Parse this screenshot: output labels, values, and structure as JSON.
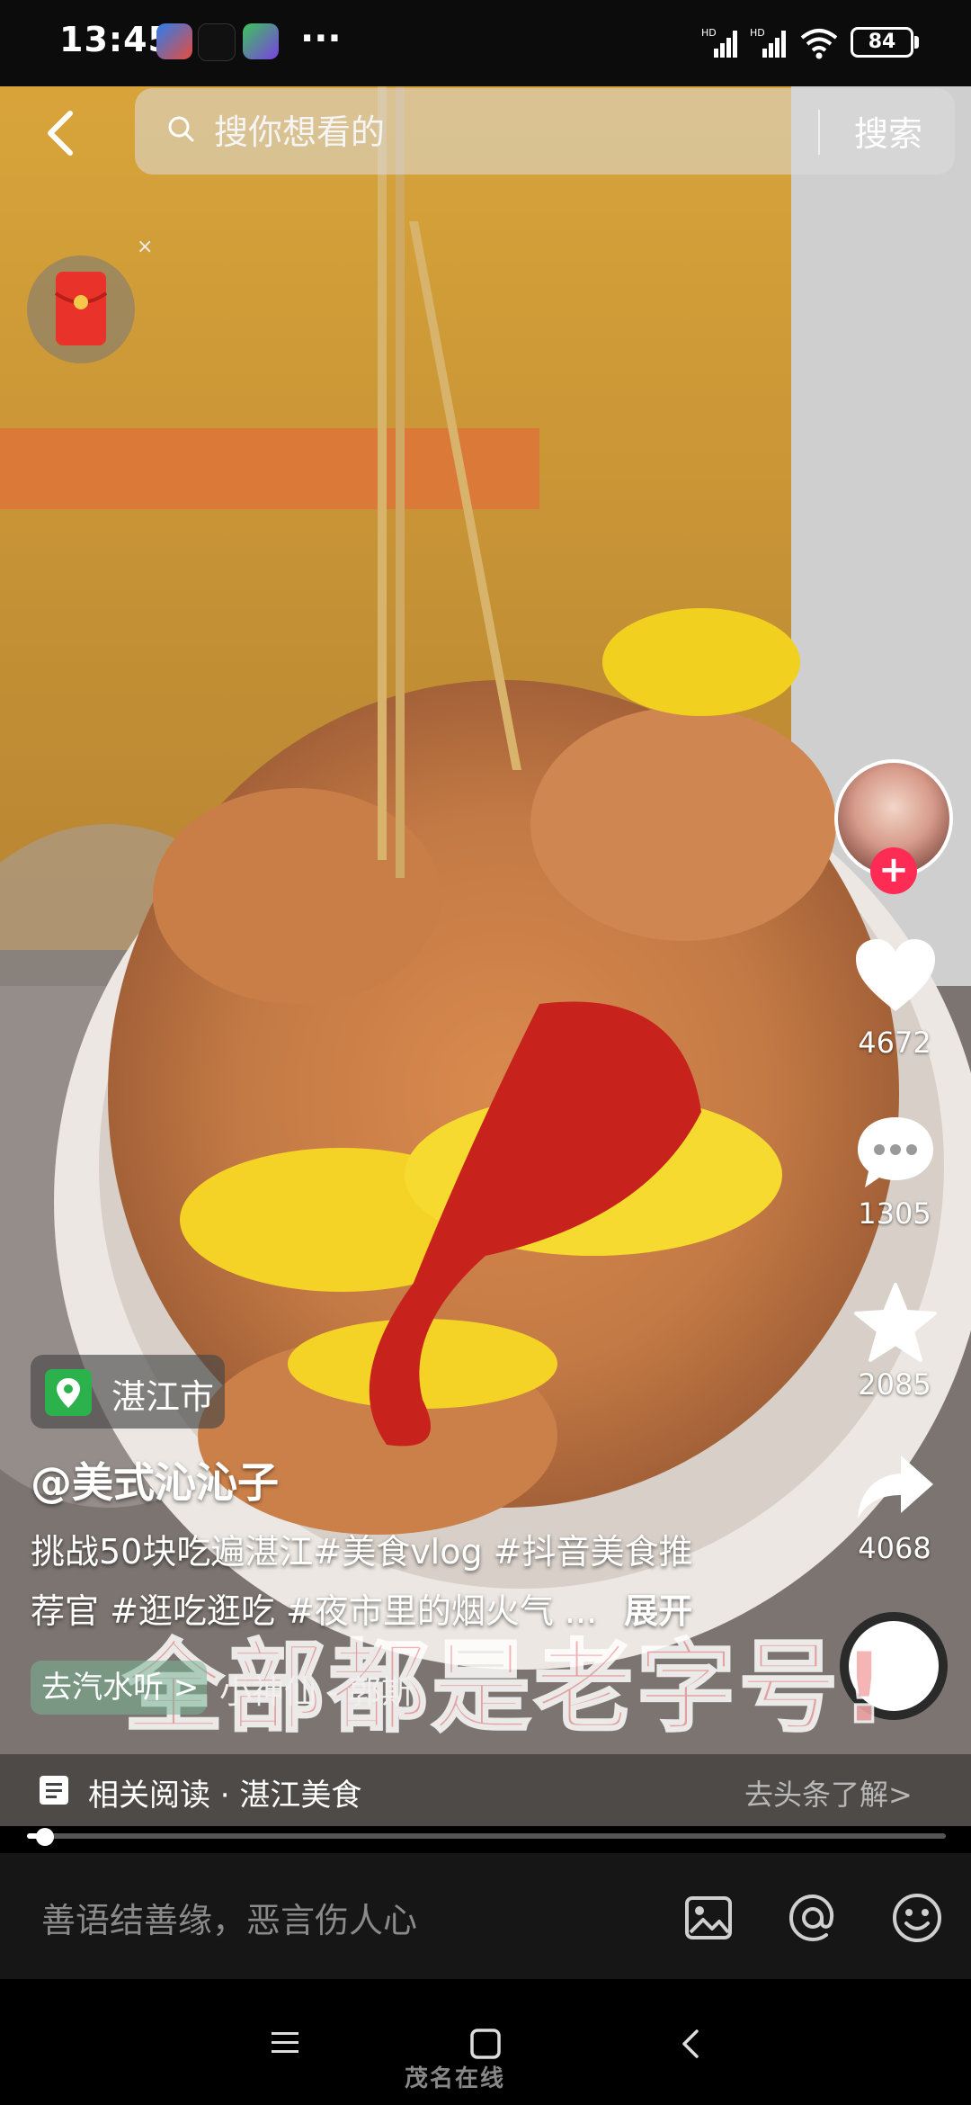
{
  "status_bar": {
    "time": "13:45",
    "more": "···",
    "battery": "84",
    "signal_labels": [
      "HD",
      "HD"
    ]
  },
  "search": {
    "placeholder": "搜你想看的",
    "button_label": "搜索"
  },
  "redpacket": {
    "close": "×"
  },
  "rail": {
    "likes": "4672",
    "comments": "1305",
    "favorites": "2085",
    "shares": "4068"
  },
  "caption": {
    "location": "湛江市",
    "author": "@美式沁沁子",
    "line1": "挑战50块吃遍湛江#美食vlog #抖音美食推",
    "line2": "荐官 #逛吃逛吃 #夜市里的烟火气 ...",
    "expand": "展开",
    "music_chip": "去汽水听 >",
    "music_title": "小神仙 - 郭斯",
    "overlay": "全部都是老字号!"
  },
  "related": {
    "label": "相关阅读 · 湛江美食",
    "cta": "去头条了解>"
  },
  "video": {
    "progress_fraction": 0.02
  },
  "comment": {
    "placeholder": "善语结善缘，恶言伤人心"
  },
  "watermark": "茂名在线",
  "colors": {
    "accent": "#fe2c55",
    "status_bar": "#0c0c0c",
    "comment_bar": "#161616"
  }
}
